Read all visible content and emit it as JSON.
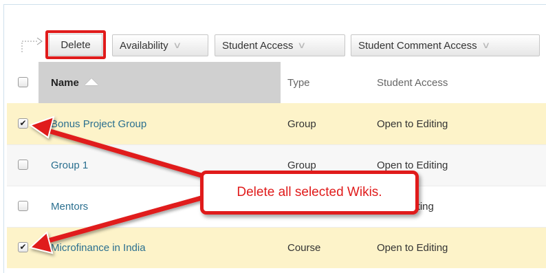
{
  "toolbar": {
    "delete_label": "Delete",
    "availability_label": "Availability",
    "student_access_label": "Student Access",
    "student_comment_access_label": "Student Comment Access",
    "dropdown_glyph": "≫"
  },
  "table": {
    "headers": {
      "name": "Name",
      "type": "Type",
      "student_access": "Student Access"
    },
    "sort": {
      "column": "name",
      "direction": "ascending"
    },
    "rows": [
      {
        "name": "Bonus Project Group",
        "type": "Group",
        "student_access": "Open to Editing",
        "checked": true
      },
      {
        "name": "Group 1",
        "type": "Group",
        "student_access": "Open to Editing",
        "checked": false
      },
      {
        "name": "Mentors",
        "type": "",
        "student_access": "Editing",
        "checked": false
      },
      {
        "name": "Microfinance in India",
        "type": "Course",
        "student_access": "Open to Editing",
        "checked": true
      }
    ]
  },
  "callout": {
    "text": "Delete all selected Wikis."
  },
  "colors": {
    "highlight_red": "#e01b1b",
    "selected_row": "#fdf3c9",
    "link": "#2a6f8f",
    "header_sorted": "#d0d0d0"
  },
  "icons": {
    "checked_glyph": "✔",
    "sort_glyph": "sort-ascending-triangle-icon"
  }
}
